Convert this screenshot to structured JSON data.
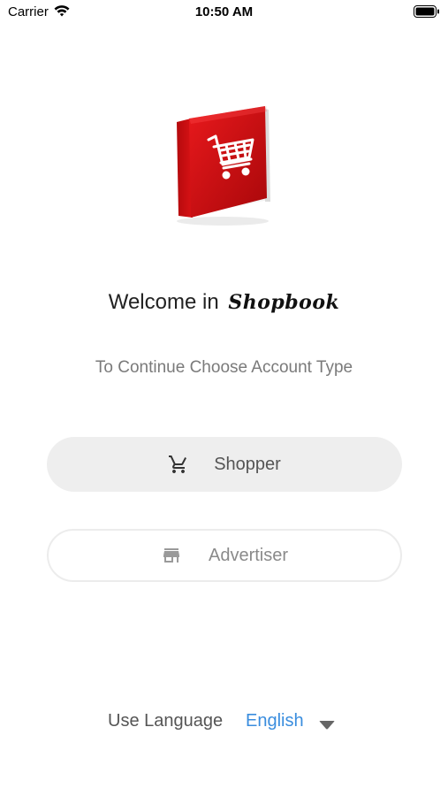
{
  "status_bar": {
    "carrier": "Carrier",
    "time": "10:50 AM"
  },
  "welcome": {
    "prefix": "Welcome in",
    "brand": "Shopbook"
  },
  "subtitle": "To Continue Choose Account Type",
  "buttons": {
    "shopper_label": "Shopper",
    "advertiser_label": "Advertiser"
  },
  "language": {
    "label": "Use Language",
    "value": "English"
  },
  "colors": {
    "book_red": "#d40f12",
    "link_blue": "#3a8dde",
    "button_gray": "#eeeeee"
  },
  "icons": {
    "logo": "book-with-cart-icon",
    "shopper": "cart-icon",
    "advertiser": "store-icon",
    "language": "caret-down-icon"
  }
}
